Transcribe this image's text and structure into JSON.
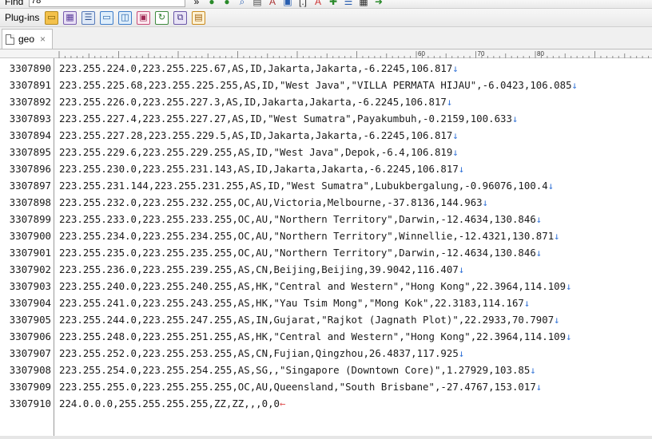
{
  "toolbar": {
    "find_label": "Find",
    "find_value": "78",
    "plugins_label": "Plug-ins"
  },
  "tabs": [
    {
      "label": "geo",
      "close": "×"
    }
  ],
  "ruler": {
    "marks": [
      "60",
      "70",
      "80"
    ]
  },
  "editor": {
    "eol_glyph": "↓",
    "eof_glyph": "←",
    "lines": [
      {
        "num": "3307890",
        "text": "223.255.224.0,223.255.225.67,AS,ID,Jakarta,Jakarta,-6.2245,106.817"
      },
      {
        "num": "3307891",
        "text": "223.255.225.68,223.255.225.255,AS,ID,\"West Java\",\"VILLA PERMATA HIJAU\",-6.0423,106.085"
      },
      {
        "num": "3307892",
        "text": "223.255.226.0,223.255.227.3,AS,ID,Jakarta,Jakarta,-6.2245,106.817"
      },
      {
        "num": "3307893",
        "text": "223.255.227.4,223.255.227.27,AS,ID,\"West Sumatra\",Payakumbuh,-0.2159,100.633"
      },
      {
        "num": "3307894",
        "text": "223.255.227.28,223.255.229.5,AS,ID,Jakarta,Jakarta,-6.2245,106.817"
      },
      {
        "num": "3307895",
        "text": "223.255.229.6,223.255.229.255,AS,ID,\"West Java\",Depok,-6.4,106.819"
      },
      {
        "num": "3307896",
        "text": "223.255.230.0,223.255.231.143,AS,ID,Jakarta,Jakarta,-6.2245,106.817"
      },
      {
        "num": "3307897",
        "text": "223.255.231.144,223.255.231.255,AS,ID,\"West Sumatra\",Lubukbergalung,-0.96076,100.4"
      },
      {
        "num": "3307898",
        "text": "223.255.232.0,223.255.232.255,OC,AU,Victoria,Melbourne,-37.8136,144.963"
      },
      {
        "num": "3307899",
        "text": "223.255.233.0,223.255.233.255,OC,AU,\"Northern Territory\",Darwin,-12.4634,130.846"
      },
      {
        "num": "3307900",
        "text": "223.255.234.0,223.255.234.255,OC,AU,\"Northern Territory\",Winnellie,-12.4321,130.871"
      },
      {
        "num": "3307901",
        "text": "223.255.235.0,223.255.235.255,OC,AU,\"Northern Territory\",Darwin,-12.4634,130.846"
      },
      {
        "num": "3307902",
        "text": "223.255.236.0,223.255.239.255,AS,CN,Beijing,Beijing,39.9042,116.407"
      },
      {
        "num": "3307903",
        "text": "223.255.240.0,223.255.240.255,AS,HK,\"Central and Western\",\"Hong Kong\",22.3964,114.109"
      },
      {
        "num": "3307904",
        "text": "223.255.241.0,223.255.243.255,AS,HK,\"Yau Tsim Mong\",\"Mong Kok\",22.3183,114.167"
      },
      {
        "num": "3307905",
        "text": "223.255.244.0,223.255.247.255,AS,IN,Gujarat,\"Rajkot (Jagnath Plot)\",22.2933,70.7907"
      },
      {
        "num": "3307906",
        "text": "223.255.248.0,223.255.251.255,AS,HK,\"Central and Western\",\"Hong Kong\",22.3964,114.109"
      },
      {
        "num": "3307907",
        "text": "223.255.252.0,223.255.253.255,AS,CN,Fujian,Qingzhou,26.4837,117.925"
      },
      {
        "num": "3307908",
        "text": "223.255.254.0,223.255.254.255,AS,SG,,\"Singapore (Downtown Core)\",1.27929,103.85"
      },
      {
        "num": "3307909",
        "text": "223.255.255.0,223.255.255.255,OC,AU,Queensland,\"South Brisbane\",-27.4767,153.017"
      },
      {
        "num": "3307910",
        "text": "224.0.0.0,255.255.255.255,ZZ,ZZ,,,0,0",
        "last": true
      }
    ]
  }
}
